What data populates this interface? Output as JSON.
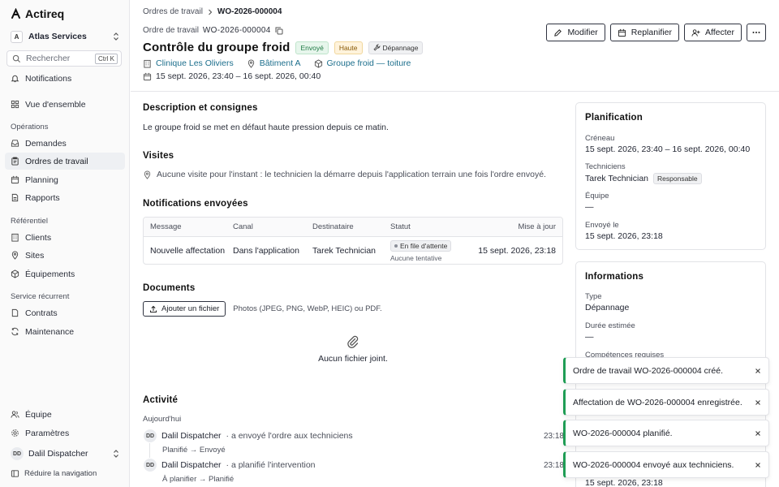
{
  "sidebar": {
    "logo": "Actireq",
    "org_badge": "A",
    "org_name": "Atlas Services",
    "search_placeholder": "Rechercher",
    "search_shortcut": "Ctrl K",
    "notifications": "Notifications",
    "overview": "Vue d'ensemble",
    "section_operations": "Opérations",
    "requests": "Demandes",
    "work_orders": "Ordres de travail",
    "planning": "Planning",
    "reports": "Rapports",
    "section_reference": "Référentiel",
    "clients": "Clients",
    "sites": "Sites",
    "equipment": "Équipements",
    "section_recurring": "Service récurrent",
    "contracts": "Contrats",
    "maintenance": "Maintenance",
    "team": "Équipe",
    "settings": "Paramètres",
    "user_initials": "DD",
    "user_name": "Dalil Dispatcher",
    "collapse": "Réduire la navigation"
  },
  "header": {
    "breadcrumb_parent": "Ordres de travail",
    "breadcrumb_current": "WO-2026-000004",
    "wo_label": "Ordre de travail",
    "wo_number": "WO-2026-000004",
    "title": "Contrôle du groupe froid",
    "chip_status": "Envoyé",
    "chip_priority": "Haute",
    "chip_type": "Dépannage",
    "client": "Clinique Les Oliviers",
    "site": "Bâtiment A",
    "equipment": "Groupe froid — toiture",
    "window": "15 sept. 2026, 23:40 – 16 sept. 2026, 00:40",
    "btn_edit": "Modifier",
    "btn_replan": "Replanifier",
    "btn_assign": "Affecter"
  },
  "description": {
    "title": "Description et consignes",
    "text": "Le groupe froid se met en défaut haute pression depuis ce matin."
  },
  "visits": {
    "title": "Visites",
    "empty": "Aucune visite pour l'instant : le technicien la démarre depuis l'application terrain une fois l'ordre envoyé."
  },
  "notifications": {
    "title": "Notifications envoyées",
    "columns": [
      "Message",
      "Canal",
      "Destinataire",
      "Statut",
      "Mise à jour"
    ],
    "rows": [
      {
        "message": "Nouvelle affectation",
        "channel": "Dans l'application",
        "recipient": "Tarek Technician",
        "status": "En file d'attente",
        "status_sub": "Aucune tentative",
        "updated": "15 sept. 2026, 23:18"
      }
    ]
  },
  "documents": {
    "title": "Documents",
    "add_button": "Ajouter un fichier",
    "hint": "Photos (JPEG, PNG, WebP, HEIC) ou PDF.",
    "empty": "Aucun fichier joint."
  },
  "activity": {
    "title": "Activité",
    "day": "Aujourd'hui",
    "items": [
      {
        "initials": "DD",
        "actor": "Dalil Dispatcher",
        "text": "· a envoyé l'ordre aux techniciens",
        "time": "23:18",
        "sub": "Planifié → Envoyé"
      },
      {
        "initials": "DD",
        "actor": "Dalil Dispatcher",
        "text": "· a planifié l'intervention",
        "time": "23:18",
        "sub": "À planifier → Planifié"
      }
    ]
  },
  "planning": {
    "title": "Planification",
    "slot_label": "Créneau",
    "slot_value": "15 sept. 2026, 23:40 – 16 sept. 2026, 00:40",
    "techs_label": "Techniciens",
    "tech_name": "Tarek Technician",
    "tech_role": "Responsable",
    "team_label": "Équipe",
    "team_value": "—",
    "sent_label": "Envoyé le",
    "sent_value": "15 sept. 2026, 23:18"
  },
  "info": {
    "title": "Informations",
    "type_label": "Type",
    "type_value": "Dépannage",
    "duration_label": "Durée estimée",
    "duration_value": "—",
    "skills_label": "Compétences requises",
    "bottom_value": "15 sept. 2026, 23:18"
  },
  "toasts": [
    "Ordre de travail WO-2026-000004 créé.",
    "Affectation de WO-2026-000004 enregistrée.",
    "WO-2026-000004 planifié.",
    "WO-2026-000004 envoyé aux techniciens."
  ],
  "colors": {
    "accent_link": "#1c6e8c",
    "success": "#1f9d55",
    "status_sent_bg": "#e7f6ec",
    "priority_high_bg": "#fff3dc"
  },
  "icons": {
    "logo": "logo-icon",
    "search": "search-icon",
    "bell": "bell-icon",
    "copy": "copy-icon",
    "close": "close-icon"
  }
}
